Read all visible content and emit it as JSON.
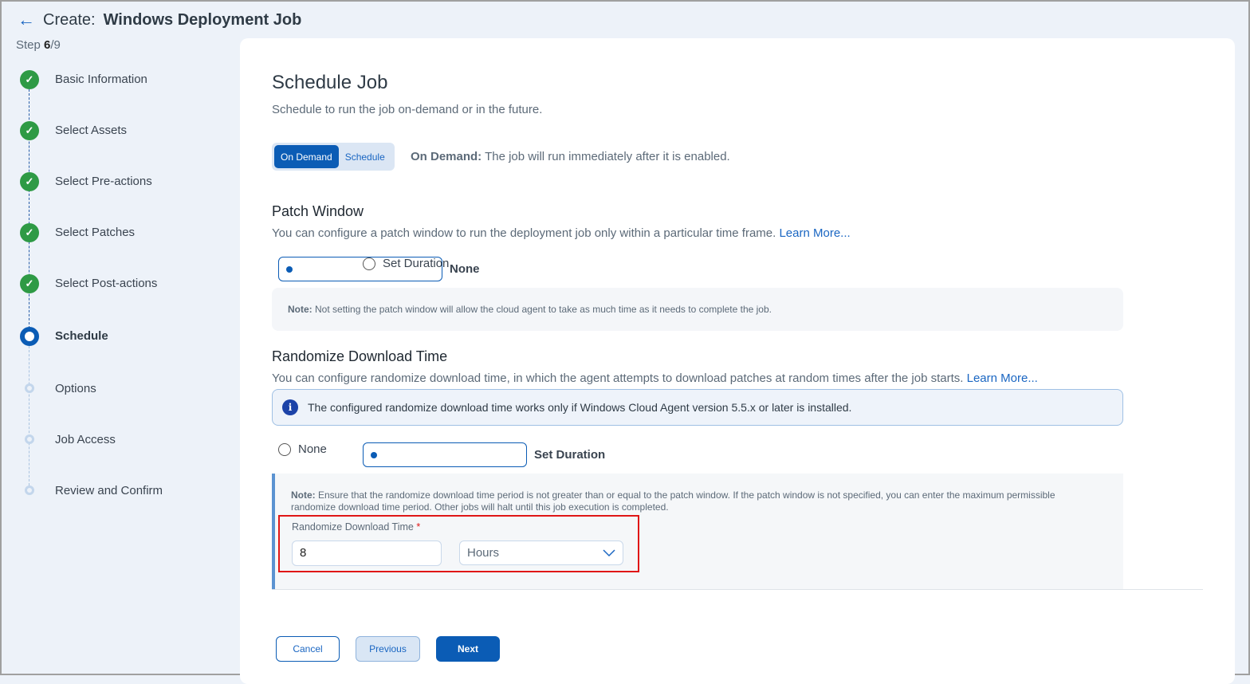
{
  "header": {
    "prefix": "Create:",
    "title": "Windows Deployment Job",
    "step_label": "Step",
    "step_current": "6",
    "step_total": "/9"
  },
  "steps": [
    {
      "label": "Basic Information",
      "state": "done"
    },
    {
      "label": "Select Assets",
      "state": "done"
    },
    {
      "label": "Select Pre-actions",
      "state": "done"
    },
    {
      "label": "Select Patches",
      "state": "done"
    },
    {
      "label": "Select Post-actions",
      "state": "done"
    },
    {
      "label": "Schedule",
      "state": "current"
    },
    {
      "label": "Options",
      "state": "future"
    },
    {
      "label": "Job Access",
      "state": "future"
    },
    {
      "label": "Review and Confirm",
      "state": "future"
    }
  ],
  "main": {
    "title": "Schedule Job",
    "subtitle": "Schedule to run the job on-demand or in the future.",
    "toggle": {
      "on_demand": "On Demand",
      "schedule": "Schedule",
      "selected": "On Demand"
    },
    "mode_desc_label": "On Demand:",
    "mode_desc": " The job will run immediately after it is enabled.",
    "patch_window": {
      "title": "Patch Window",
      "desc": "You can configure a patch window to run the deployment job only within a particular time frame. ",
      "learn_more": "Learn More...",
      "options": [
        "None",
        "Set Duration"
      ],
      "selected": "None",
      "note_label": "Note:",
      "note": " Not setting the patch window will allow the cloud agent to take as much time as it needs to complete the job."
    },
    "randomize": {
      "title": "Randomize Download Time",
      "desc": "You can configure randomize download time, in which the agent attempts to download patches at random times after the job starts. ",
      "learn_more": "Learn More...",
      "info": "The configured randomize download time works only if Windows Cloud Agent version 5.5.x or later is installed.",
      "options": [
        "None",
        "Set Duration"
      ],
      "selected": "Set Duration",
      "note_label": "Note:",
      "note": " Ensure that the randomize download time period is not greater than or equal to the patch window. If the patch window is not specified, you can enter the maximum permissible randomize download time period. Other jobs will halt until this job execution is completed.",
      "field_label": "Randomize Download Time",
      "required": "*",
      "value": "8",
      "unit": "Hours"
    }
  },
  "footer": {
    "cancel": "Cancel",
    "previous": "Previous",
    "next": "Next"
  },
  "colors": {
    "primary": "#0b5cb5",
    "success": "#2e9a45",
    "highlight": "#e01616"
  }
}
